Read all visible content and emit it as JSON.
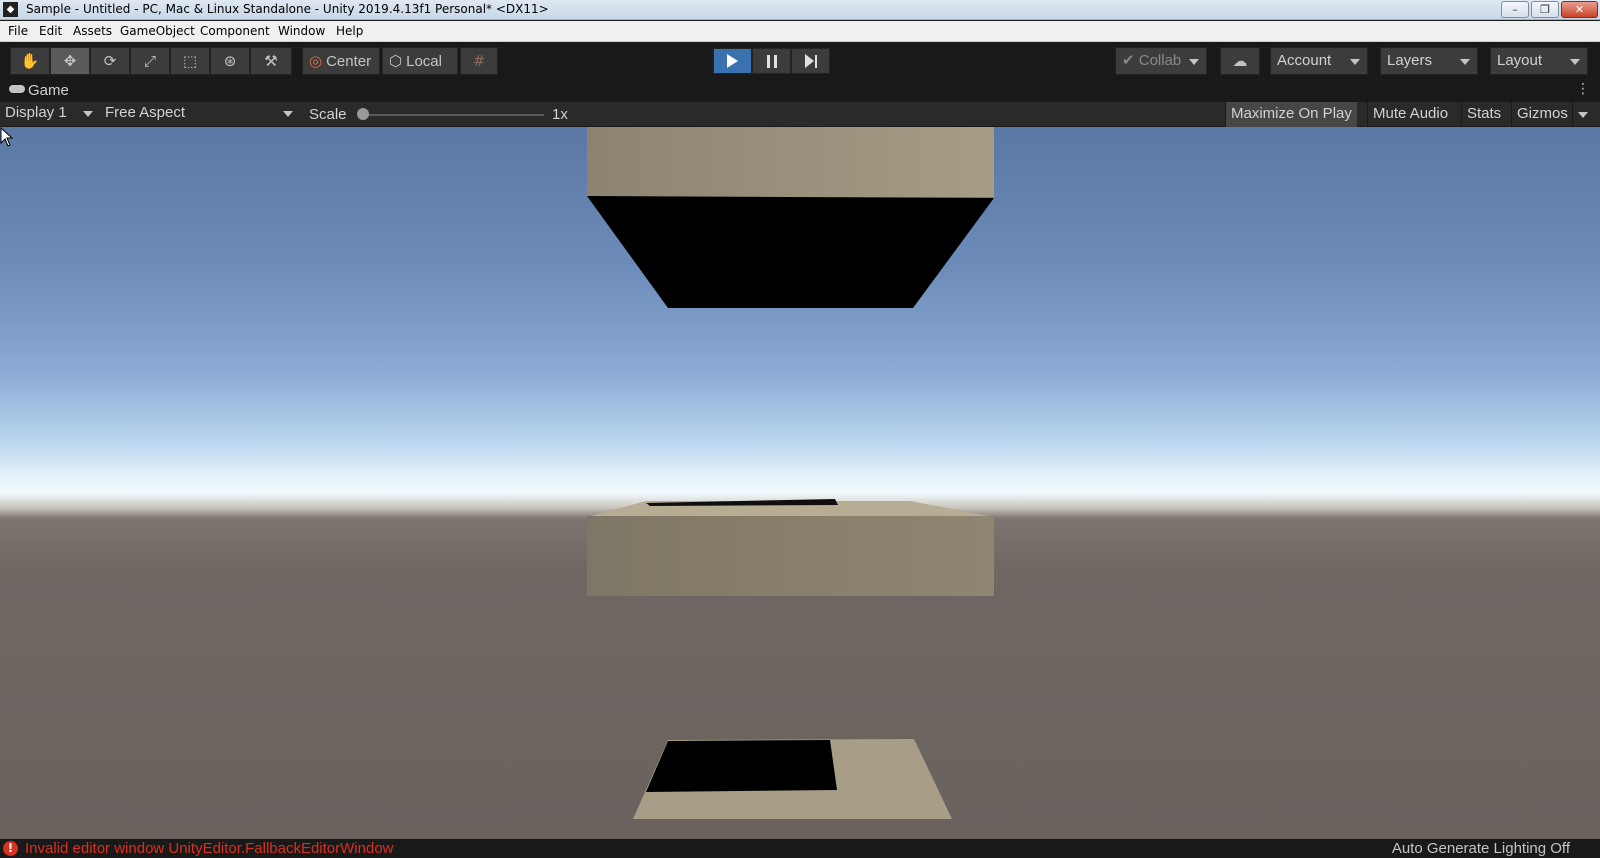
{
  "window": {
    "title": "Sample - Untitled - PC, Mac & Linux Standalone - Unity 2019.4.13f1 Personal* <DX11>",
    "minimize": "–",
    "maximize": "❐",
    "close": "✕"
  },
  "menu": [
    "File",
    "Edit",
    "Assets",
    "GameObject",
    "Component",
    "Window",
    "Help"
  ],
  "toolbar": {
    "tools": [
      "hand-icon",
      "move-icon",
      "rotate-icon",
      "scale-icon",
      "rect-icon",
      "transform-icon",
      "custom-tool-icon"
    ],
    "active_tool": "move-icon",
    "pivot_label": "Center",
    "space_label": "Local",
    "collab_label": "Collab",
    "account_label": "Account",
    "layers_label": "Layers",
    "layout_label": "Layout",
    "playing": true
  },
  "game_tab": {
    "label": "Game",
    "display": "Display 1",
    "aspect": "Free Aspect",
    "scale_label": "Scale",
    "scale_value": "1x",
    "scale_fraction": 0.0,
    "maximize_on_play": "Maximize On Play",
    "mute_audio": "Mute Audio",
    "stats": "Stats",
    "gizmos": "Gizmos"
  },
  "colors": {
    "play_active": "#3a72b0",
    "error": "#d9301f",
    "platform_light": "#a49a86",
    "platform_mid": "#8a8170"
  },
  "status": {
    "error_icon": "!",
    "error_message": "Invalid editor window UnityEditor.FallbackEditorWindow",
    "lighting": "Auto Generate Lighting Off"
  }
}
